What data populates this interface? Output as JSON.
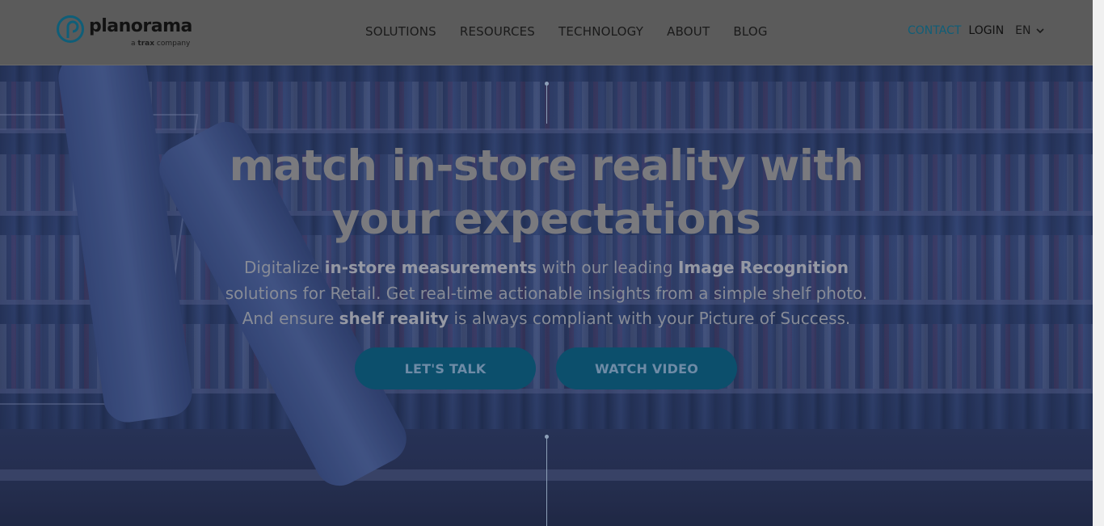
{
  "brand": {
    "name": "planorama",
    "sub_prefix": "a",
    "sub_bold": "trax",
    "sub_suffix": "company",
    "mark_color": "#0f5e78"
  },
  "nav": {
    "items": [
      {
        "label": "SOLUTIONS"
      },
      {
        "label": "RESOURCES"
      },
      {
        "label": "TECHNOLOGY"
      },
      {
        "label": "ABOUT"
      },
      {
        "label": "BLOG"
      }
    ],
    "contact": "CONTACT",
    "login": "LOGIN",
    "language": "EN"
  },
  "hero": {
    "headline_line1": "match in-store reality with",
    "headline_line2": "your expectations",
    "sub": {
      "p1": "Digitalize ",
      "b1": "in-store measurements",
      "p2": " with our leading ",
      "b2": "Image Recognition",
      "p3": " solutions for Retail. Get real-time actionable insights from a simple shelf photo. And ensure ",
      "b3": "shelf reality",
      "p4": " is always compliant with your Picture of Success."
    },
    "cta_primary": "LET'S TALK",
    "cta_secondary": "WATCH VIDEO"
  },
  "colors": {
    "accent": "#0f5e78",
    "button_bg": "#0c4f6c",
    "header_bg": "#5b5b5b"
  },
  "icons": {
    "logo": "planorama-logo-icon",
    "lang_caret": "chevron-down-icon"
  }
}
